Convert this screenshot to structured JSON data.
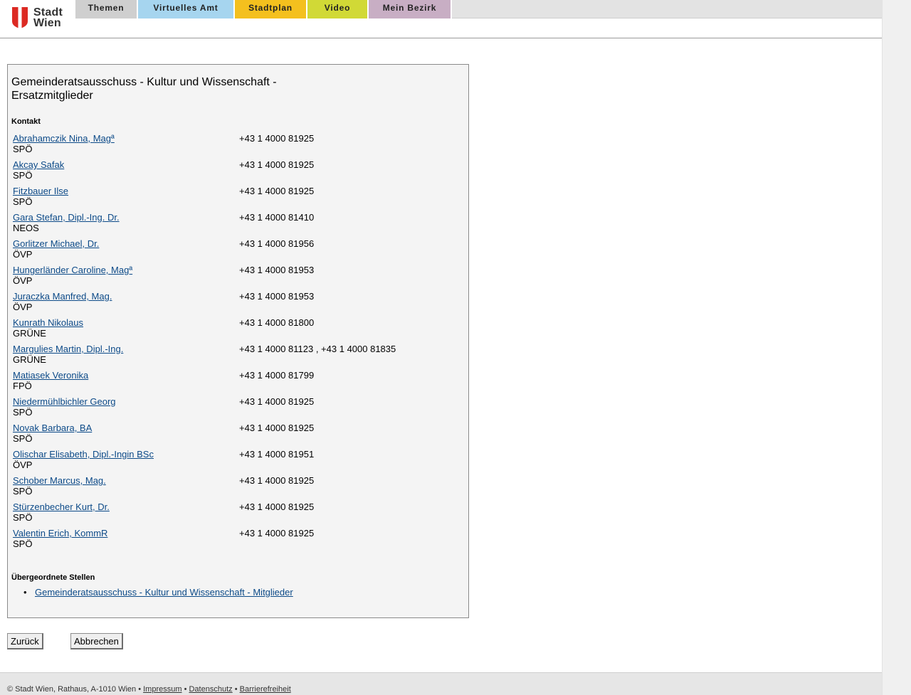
{
  "header": {
    "logo": {
      "line1": "Stadt",
      "line2": "Wien",
      "shield_color": "#dc2a23"
    },
    "nav": [
      {
        "label": "Themen",
        "color": "#cfcfcf"
      },
      {
        "label": "Virtuelles Amt",
        "color": "#a6d5ef"
      },
      {
        "label": "Stadtplan",
        "color": "#f4c01e"
      },
      {
        "label": "Video",
        "color": "#d1d936"
      },
      {
        "label": "Mein Bezirk",
        "color": "#c8aec4"
      }
    ]
  },
  "main": {
    "title": "Gemeinderatsausschuss - Kultur und Wissenschaft - Ersatzmitglieder",
    "contact_label": "Kontakt",
    "contacts": [
      {
        "name": "Abrahamczik Nina, Magª",
        "party": "SPÖ",
        "phone": "+43 1 4000 81925"
      },
      {
        "name": "Akcay Safak",
        "party": "SPÖ",
        "phone": "+43 1 4000 81925"
      },
      {
        "name": "Fitzbauer Ilse",
        "party": "SPÖ",
        "phone": "+43 1 4000 81925"
      },
      {
        "name": "Gara Stefan, Dipl.-Ing. Dr.",
        "party": "NEOS",
        "phone": "+43 1 4000 81410"
      },
      {
        "name": "Gorlitzer Michael, Dr.",
        "party": "ÖVP",
        "phone": "+43 1 4000 81956"
      },
      {
        "name": "Hungerländer Caroline, Magª",
        "party": "ÖVP",
        "phone": "+43 1 4000 81953"
      },
      {
        "name": "Juraczka Manfred, Mag.",
        "party": "ÖVP",
        "phone": "+43 1 4000 81953"
      },
      {
        "name": "Kunrath Nikolaus",
        "party": "GRÜNE",
        "phone": "+43 1 4000 81800"
      },
      {
        "name": "Margulies Martin, Dipl.-Ing.",
        "party": "GRÜNE",
        "phone": "+43 1 4000 81123 , +43 1 4000 81835"
      },
      {
        "name": "Matiasek Veronika",
        "party": "FPÖ",
        "phone": "+43 1 4000 81799"
      },
      {
        "name": "Niedermühlbichler Georg",
        "party": "SPÖ",
        "phone": "+43 1 4000 81925"
      },
      {
        "name": "Novak Barbara, BA",
        "party": "SPÖ",
        "phone": "+43 1 4000 81925"
      },
      {
        "name": "Olischar Elisabeth, Dipl.-Ingin BSc",
        "party": "ÖVP",
        "phone": "+43 1 4000 81951"
      },
      {
        "name": "Schober Marcus, Mag.",
        "party": "SPÖ",
        "phone": "+43 1 4000 81925"
      },
      {
        "name": "Stürzenbecher Kurt, Dr.",
        "party": "SPÖ",
        "phone": "+43 1 4000 81925"
      },
      {
        "name": "Valentin Erich, KommR",
        "party": "SPÖ",
        "phone": "+43 1 4000 81925"
      }
    ],
    "parent_label": "Übergeordnete Stellen",
    "parents": [
      {
        "label": "Gemeinderatsausschuss - Kultur und Wissenschaft - Mitglieder"
      }
    ]
  },
  "buttons": {
    "back": "Zurück",
    "cancel": "Abbrechen"
  },
  "footer": {
    "copyright": "© Stadt Wien, Rathaus, A-1010 Wien",
    "separator": " • ",
    "links": [
      "Impressum",
      "Datenschutz",
      "Barrierefreiheit"
    ]
  }
}
